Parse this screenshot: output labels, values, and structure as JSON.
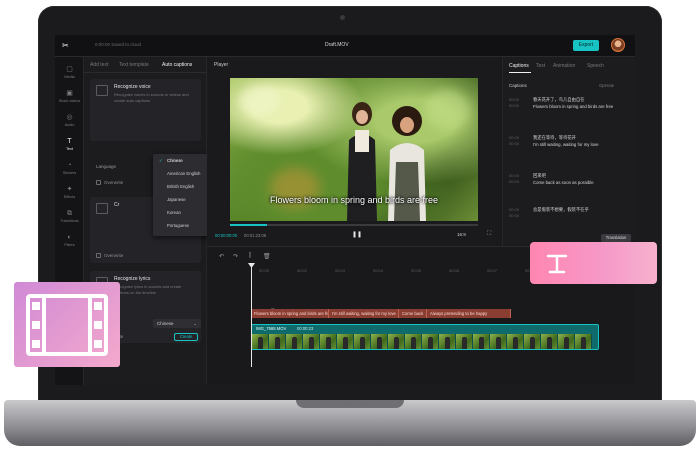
{
  "device": {
    "model_label": "MacBook Pro"
  },
  "app": {
    "save_status": "0:00:00 Saved to cloud",
    "project_title": "Draft.MOV",
    "export_label": "Export",
    "accent_color": "#17c3c3"
  },
  "rail": {
    "items": [
      {
        "icon": "media-icon",
        "label": "Media"
      },
      {
        "icon": "stock-icon",
        "label": "Stock videos"
      },
      {
        "icon": "audio-icon",
        "label": "Audio"
      },
      {
        "icon": "text-icon",
        "label": "Text"
      },
      {
        "icon": "stickers-icon",
        "label": "Stickers"
      },
      {
        "icon": "effects-icon",
        "label": "Effects"
      },
      {
        "icon": "transitions-icon",
        "label": "Transitions"
      },
      {
        "icon": "filters-icon",
        "label": "Filters"
      }
    ],
    "active": "Text"
  },
  "left_panel": {
    "tabs": [
      "Add text",
      "Text template",
      "Auto captions"
    ],
    "active_tab": "Auto captions",
    "recognize_voice": {
      "title": "Recognize voice",
      "description": "Recognize voices in sounds or videos and create auto captions",
      "language_label": "Language",
      "language_value": "Chinese",
      "checkbox_label": "Overwrite"
    },
    "second_card": {
      "title": "Cr",
      "checkbox_label": "Overwrite"
    },
    "recognize_lyrics": {
      "title": "Recognize lyrics",
      "description": "Recognize lyrics in sounds and create captions on the timeline",
      "language_value": "Chinese",
      "checkbox_label": "Overwrite",
      "button_label": "Create"
    },
    "language_options": [
      "Chinese",
      "American English",
      "British English",
      "Japanese",
      "Korean",
      "Portuguese"
    ],
    "selected_option": "Chinese"
  },
  "player": {
    "title": "Player",
    "caption": "Flowers bloom in spring and birds are free",
    "current_time": "00:00:00:00",
    "total_time": "00:01:23:08",
    "progress": 0.15,
    "aspect_ratio": "16:9"
  },
  "right_panel": {
    "tabs": [
      "Captions",
      "Text",
      "Animation",
      "Speech"
    ],
    "active_tab": "Captions",
    "subheader": "Captions",
    "subheader_right": "Operate",
    "captions": [
      {
        "time": "00:00\n00:00",
        "text": "春天花开了，鸟儿自由自在\nFlowers bloom in spring and birds are free"
      },
      {
        "time": "00:00\n00:00",
        "text": "我还在等待，等待花开\nI'm still waiting, waiting for my love"
      },
      {
        "time": "00:00\n00:00",
        "text": "回来吧\nCome back as soon as possible"
      },
      {
        "time": "00:00\n00:00",
        "text": "总是假装不想要，假装不在乎"
      }
    ],
    "translation_label": "Translation"
  },
  "timeline": {
    "tools": [
      "undo-icon",
      "redo-icon",
      "split-icon",
      "delete-icon"
    ],
    "ruler": [
      "00:00",
      "00:02",
      "00:03",
      "00:04",
      "00:05",
      "00:06",
      "00:07",
      "00:08",
      "00:09"
    ],
    "subtitle_segments": [
      "Flowers bloom in spring and birds are free",
      "I'm still waiting, waiting for my love",
      "Come back",
      "Always pretending to be happy"
    ],
    "video_clip": {
      "name": "IMG_7568.MOV",
      "duration": "00:00:23"
    }
  }
}
